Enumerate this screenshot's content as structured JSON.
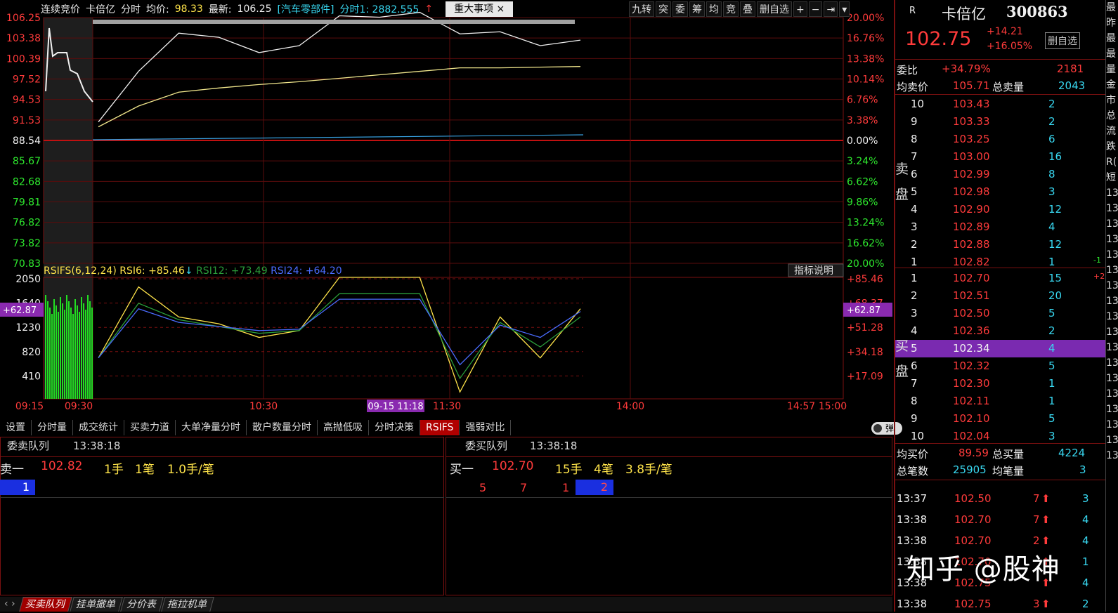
{
  "info": {
    "auction": "连续竞价",
    "name": "卡倍亿",
    "mode": "分时",
    "avg_label": "均价:",
    "avg": "98.33",
    "last_label": "最新:",
    "last": "106.25",
    "sector": "[汽车零部件]",
    "fs1": "分时1: 2882.555",
    "major": "重大事项",
    "close": "×"
  },
  "tools": [
    "九转",
    "突",
    "委",
    "筹",
    "均",
    "竞",
    "叠",
    "删自选",
    "+",
    "−",
    "⇥",
    "▾"
  ],
  "price_axis": [
    "106.25",
    "103.38",
    "100.39",
    "97.52",
    "94.53",
    "91.53",
    "88.54",
    "85.67",
    "82.68",
    "79.81",
    "76.82",
    "73.82",
    "70.83"
  ],
  "pct_axis": [
    "20.00%",
    "16.76%",
    "13.38%",
    "10.14%",
    "6.76%",
    "3.38%",
    "0.00%",
    "3.24%",
    "6.62%",
    "9.86%",
    "13.24%",
    "16.62%",
    "20.00%"
  ],
  "rsi": {
    "title": "RSIFS(6,12,24)",
    "rsi6": "RSI6: +85.46",
    "rsi12": "RSI12: +73.49",
    "rsi24": "RSI24: +64.20",
    "explain": "指标说明",
    "left_axis": [
      "2050",
      "1640",
      "1230",
      "820",
      "410"
    ],
    "right_axis": [
      "+85.46",
      "+68.37",
      "+51.28",
      "+34.18",
      "+17.09"
    ],
    "cursor": "+62.87"
  },
  "time_axis": [
    "09:15",
    "09:30",
    "10:30",
    "11:30",
    "14:00",
    "14:57",
    "15:00"
  ],
  "cursor_time": "09-15 11:18",
  "chart_data": [
    {
      "type": "line",
      "x": [
        "09:30",
        "09:45",
        "10:00",
        "10:15",
        "10:30",
        "10:45",
        "11:00",
        "11:15",
        "11:30",
        "13:00",
        "13:15",
        "13:30",
        "13:38"
      ],
      "series": [
        {
          "values": [
            91.2,
            98.5,
            104.0,
            103.4,
            101.2,
            102.2,
            106.5,
            106.3,
            107.0,
            103.9,
            104.2,
            102.2,
            103.0
          ]
        },
        {
          "values": [
            90.5,
            93.5,
            95.5,
            96.1,
            96.6,
            97.0,
            97.5,
            98.0,
            98.5,
            99.0,
            99.0,
            99.1,
            99.2
          ]
        }
      ],
      "ylim": [
        70.83,
        106.25
      ]
    },
    {
      "type": "line",
      "x": [
        "09:30",
        "09:45",
        "10:00",
        "10:15",
        "10:30",
        "10:45",
        "11:00",
        "11:15",
        "11:30",
        "13:00",
        "13:15",
        "13:30",
        "13:38"
      ],
      "series": [
        {
          "name": "RSI6",
          "values": [
            30,
            82,
            60,
            55,
            45,
            50,
            89,
            89,
            89,
            5,
            60,
            30,
            66
          ]
        },
        {
          "name": "RSI12",
          "values": [
            30,
            70,
            58,
            53,
            48,
            50,
            77,
            77,
            77,
            15,
            56,
            38,
            60
          ]
        },
        {
          "name": "RSI24",
          "values": [
            30,
            66,
            56,
            53,
            50,
            51,
            73,
            73,
            73,
            25,
            54,
            45,
            64
          ]
        }
      ],
      "ylim": [
        0,
        89
      ]
    }
  ],
  "bottom_tabs": [
    "设置",
    "分时量",
    "成交统计",
    "买卖力道",
    "大单净量分时",
    "散户数量分时",
    "高抛低吸",
    "分时决策",
    "RSIFS",
    "强弱对比"
  ],
  "popup": "弹",
  "sell_q": {
    "title": "委卖队列",
    "time": "13:38:18",
    "label": "卖一",
    "price": "102.82",
    "vol": "1手",
    "cnt": "1笔",
    "avg": "1.0手/笔",
    "cells": [
      "1"
    ]
  },
  "buy_q": {
    "title": "委买队列",
    "time": "13:38:18",
    "label": "买一",
    "price": "102.70",
    "vol": "15手",
    "cnt": "4笔",
    "avg": "3.8手/笔",
    "cells": [
      "5",
      "7",
      "1",
      "2"
    ]
  },
  "bottom_tabs2": [
    "买卖队列",
    "挂单撤单",
    "分价表",
    "拖拉机单"
  ],
  "quote": {
    "r": "R",
    "name": "卡倍亿",
    "code": "300863",
    "price": "102.75",
    "chg": "+14.21",
    "pct": "+16.05%",
    "fav": "删自选",
    "weibi_l": "委比",
    "weibi": "+34.79%",
    "weibi_n": "2181",
    "jmj_l": "均卖价",
    "jmj": "105.71",
    "zml_l": "总卖量",
    "zml": "2043",
    "sell_label": [
      "卖",
      "盘"
    ],
    "buy_label": [
      "买",
      "盘"
    ],
    "sells": [
      [
        "10",
        "103.43",
        "2",
        ""
      ],
      [
        "9",
        "103.33",
        "2",
        ""
      ],
      [
        "8",
        "103.25",
        "6",
        ""
      ],
      [
        "7",
        "103.00",
        "16",
        ""
      ],
      [
        "6",
        "102.99",
        "8",
        ""
      ],
      [
        "5",
        "102.98",
        "3",
        ""
      ],
      [
        "4",
        "102.90",
        "12",
        ""
      ],
      [
        "3",
        "102.89",
        "4",
        ""
      ],
      [
        "2",
        "102.88",
        "12",
        ""
      ],
      [
        "1",
        "102.82",
        "1",
        "-1"
      ]
    ],
    "buys": [
      [
        "1",
        "102.70",
        "15",
        "+2"
      ],
      [
        "2",
        "102.51",
        "20",
        ""
      ],
      [
        "3",
        "102.50",
        "5",
        ""
      ],
      [
        "4",
        "102.36",
        "2",
        ""
      ],
      [
        "5",
        "102.34",
        "4",
        ""
      ],
      [
        "6",
        "102.32",
        "5",
        ""
      ],
      [
        "7",
        "102.30",
        "1",
        ""
      ],
      [
        "8",
        "102.11",
        "1",
        ""
      ],
      [
        "9",
        "102.10",
        "5",
        ""
      ],
      [
        "10",
        "102.04",
        "3",
        ""
      ]
    ],
    "jmjb_l": "均买价",
    "jmjb": "89.59",
    "zmlb_l": "总买量",
    "zmlb": "4224",
    "zbs_l": "总笔数",
    "zbs": "25905",
    "jbl_l": "均笔量",
    "jbl": "3",
    "ticks": [
      [
        "13:37",
        "102.50",
        "7",
        "3"
      ],
      [
        "13:38",
        "102.70",
        "7",
        "4"
      ],
      [
        "13:38",
        "102.70",
        "2",
        "4"
      ],
      [
        "13:38",
        "102.70",
        "",
        "1"
      ],
      [
        "13:38",
        "102.75",
        "",
        "4"
      ],
      [
        "13:38",
        "102.75",
        "3",
        "2"
      ]
    ]
  },
  "edge": [
    "最",
    "昨",
    "最",
    "最",
    "量",
    "金",
    "市",
    "总",
    "流",
    "跌",
    "R(",
    "短",
    "13",
    "13",
    "13",
    "13",
    "13",
    "13",
    "13",
    "13",
    "13",
    "13",
    "13",
    "13",
    "13",
    "13",
    "13",
    "13",
    "13",
    "13"
  ],
  "watermark": "知乎 @股神"
}
